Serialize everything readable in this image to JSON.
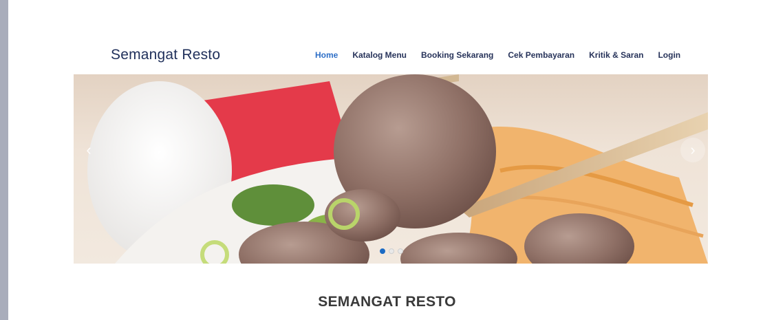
{
  "brand": {
    "name": "Semangat Resto"
  },
  "nav": {
    "items": [
      {
        "label": "Home",
        "active": true
      },
      {
        "label": "Katalog Menu"
      },
      {
        "label": "Booking Sekarang"
      },
      {
        "label": "Cek Pembayaran"
      },
      {
        "label": "Kritik & Saran"
      },
      {
        "label": "Login"
      }
    ]
  },
  "carousel": {
    "prev_icon": "chevron-left-icon",
    "next_icon": "chevron-right-icon",
    "slide_count": 3,
    "active_slide": 1
  },
  "section": {
    "title": "SEMANGAT RESTO"
  },
  "colors": {
    "brand_text": "#1f2f5a",
    "nav_active": "#2e6fc7",
    "dot_active": "#1b6bc4",
    "side_strip": "#a9adbb"
  }
}
